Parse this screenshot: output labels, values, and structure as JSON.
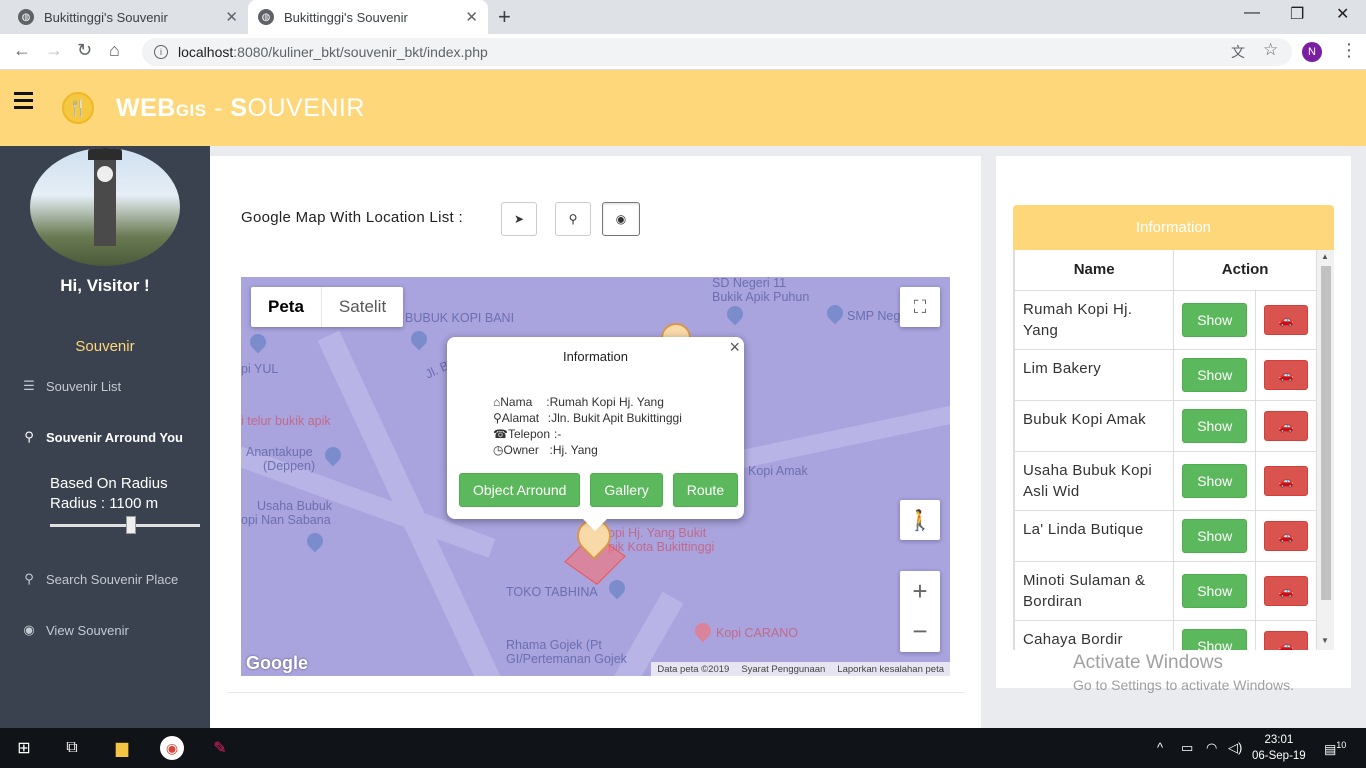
{
  "browser": {
    "tabs": [
      {
        "title": "Bukittinggi's Souvenir",
        "close": "✕"
      },
      {
        "title": "Bukittinggi's Souvenir",
        "close": "✕"
      }
    ],
    "new_tab": "+",
    "url_host": "localhost",
    "url_path": ":8080/kuliner_bkt/souvenir_bkt/index.php",
    "profile_initial": "N"
  },
  "header": {
    "brand_web": "WEB",
    "brand_gis": "GIS",
    "brand_sep": " - ",
    "brand_s": "S",
    "brand_rest": "OUVENIR"
  },
  "sidebar": {
    "greeting": "Hi, Visitor !",
    "section": "Souvenir",
    "items": [
      {
        "label": "Souvenir List",
        "icon": "list-icon"
      },
      {
        "label": "Souvenir Arround You",
        "icon": "map-pin-icon"
      },
      {
        "label": "Search Souvenir Place",
        "icon": "search-icon"
      },
      {
        "label": "View Souvenir",
        "icon": "eye-icon"
      }
    ],
    "radius_title": "Based On Radius",
    "radius_label": "Radius : 1100 m",
    "radius_value": 1100
  },
  "main": {
    "title": "Google Map With Location List :",
    "buttons": [
      "locate-icon",
      "marker-icon",
      "eye-icon"
    ]
  },
  "map": {
    "type_map": "Peta",
    "type_satellite": "Satelit",
    "pois": [
      "SD Negeri 11",
      "Bukik Apik Puhun",
      "SMP Neg",
      "BUBUK KOPI BANI",
      "pi YUL",
      "Jl. B",
      "i telur bukik apik",
      "Anantakupe",
      "(Deppen)",
      "Usaha Bubuk",
      "opi Nan Sabana",
      "Kopi Amak",
      "opi Hj. Yang Bukit",
      "pik Kota Bukittinggi",
      "TOKO TABHINA",
      "Kopi CARANO",
      "Rhama Gojek (Pt",
      "GI/Pertemanan Gojek"
    ],
    "attribution": [
      "Data peta ©2019",
      "Syarat Penggunaan",
      "Laporkan kesalahan peta"
    ],
    "zoom_in": "+",
    "zoom_out": "−",
    "google": "Google"
  },
  "infowindow": {
    "title": "Information",
    "close": "×",
    "rows": [
      {
        "icon": "home-icon",
        "key": "Nama",
        "value": ":Rumah Kopi Hj. Yang"
      },
      {
        "icon": "marker-icon",
        "key": "Alamat",
        "value": ":Jln. Bukit Apit Bukittinggi"
      },
      {
        "icon": "phone-icon",
        "key": "Telepon",
        "value": ":-"
      },
      {
        "icon": "clock-icon",
        "key": "Owner",
        "value": ":Hj. Yang"
      }
    ],
    "buttons": [
      "Object Arround",
      "Gallery",
      "Route"
    ]
  },
  "info_panel": {
    "title": "Information",
    "col_name": "Name",
    "col_action": "Action",
    "show_label": "Show",
    "rows": [
      "Rumah Kopi Hj. Yang",
      "Lim Bakery",
      "Bubuk Kopi Amak",
      "Usaha Bubuk Kopi Asli Wid",
      "La' Linda Butique",
      "Minoti Sulaman & Bordiran",
      "Cahaya Bordir"
    ]
  },
  "watermark": {
    "line1": "Activate Windows",
    "line2": "Go to Settings to activate Windows."
  },
  "taskbar": {
    "time": "23:01",
    "date": "06-Sep-19",
    "notifications": "10"
  },
  "colors": {
    "header": "#fdd77a",
    "sidebar": "#3a4250",
    "accent_green": "#5cb85c",
    "accent_red": "#d9534f",
    "map_bg": "#a9a3de"
  }
}
